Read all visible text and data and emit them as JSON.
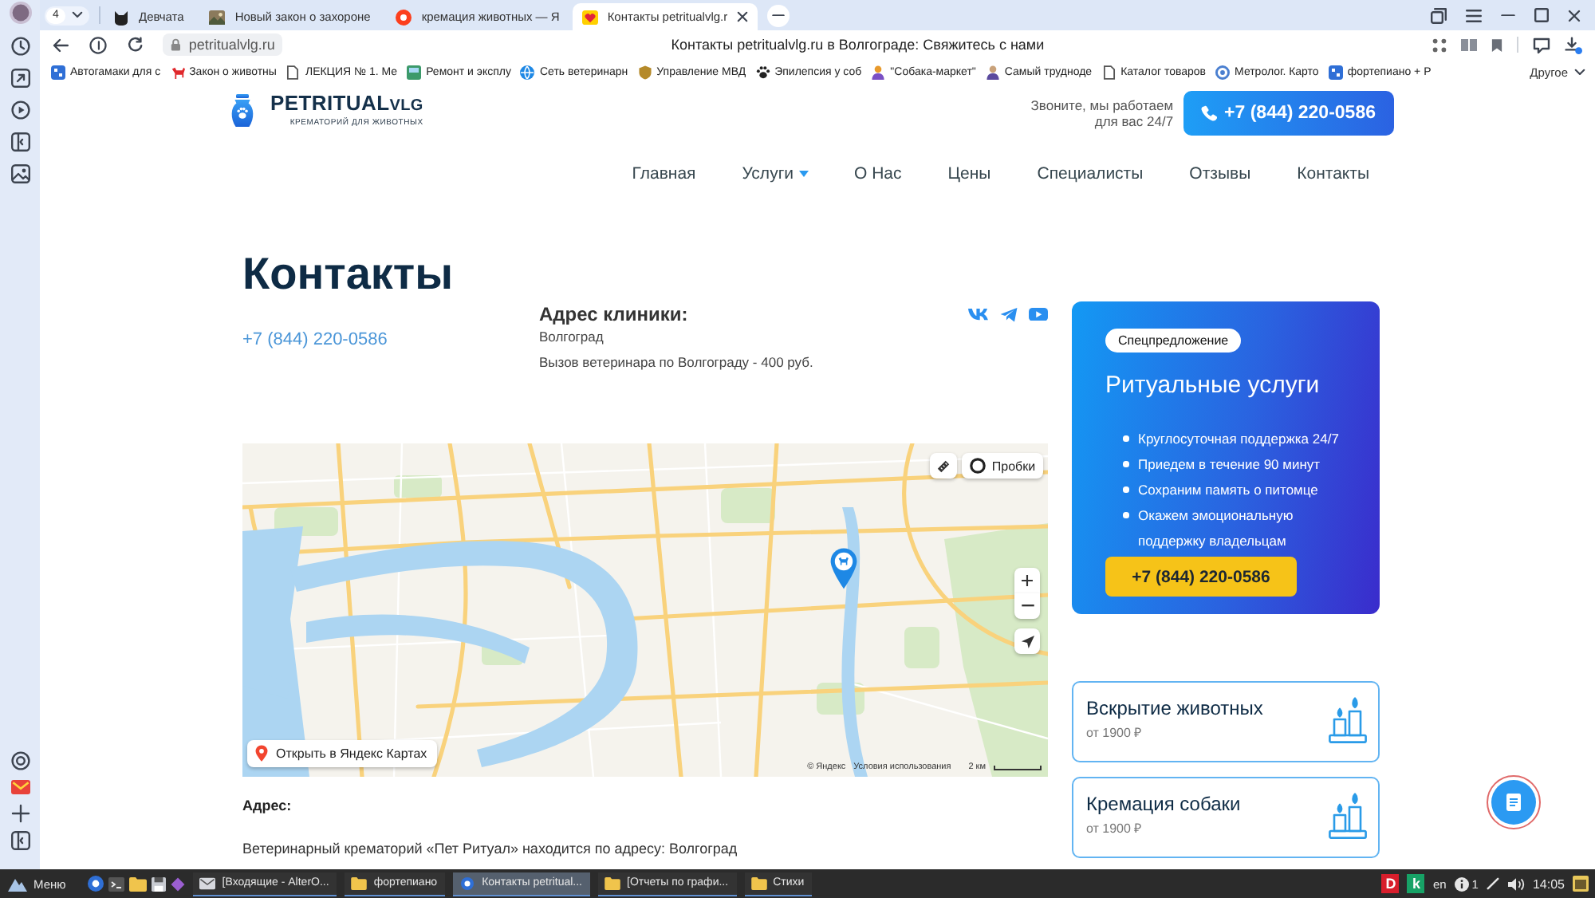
{
  "browser": {
    "tab_count": "4",
    "tabs": [
      {
        "title": "Девчата",
        "selected": false
      },
      {
        "title": "Новый закон о захороне",
        "selected": false
      },
      {
        "title": "кремация животных — Я",
        "selected": false
      },
      {
        "title": "Контакты petritualvlg.r",
        "selected": true
      }
    ],
    "url": "petritualvlg.ru",
    "page_title": "Контакты petritualvlg.ru в Волгограде: Свяжитесь с нами",
    "bookmarks": [
      "Автогамаки для с",
      "Закон о животны",
      "ЛЕКЦИЯ № 1. Ме",
      "Ремонт и эксплу",
      "Сеть ветеринарн",
      "Управление МВД",
      "Эпилепсия у соб",
      "\"Собака-маркет\"",
      "Самый трудноде",
      "Каталог товаров",
      "Метролог. Карто",
      "фортепиано + Р"
    ],
    "bookmarks_more": "Другое"
  },
  "header": {
    "brand": "PETRITUAL",
    "brand_suffix": "VLG",
    "tagline": "КРЕМАТОРИЙ ДЛЯ ЖИВОТНЫХ",
    "call_note": "Звоните, мы работаем для вас 24/7",
    "phone_button": "+7 (844) 220-0586"
  },
  "nav": [
    {
      "label": "Главная",
      "dropdown": false
    },
    {
      "label": "Услуги",
      "dropdown": true
    },
    {
      "label": "О Нас",
      "dropdown": false
    },
    {
      "label": "Цены",
      "dropdown": false
    },
    {
      "label": "Специалисты",
      "dropdown": false
    },
    {
      "label": "Отзывы",
      "dropdown": false
    },
    {
      "label": "Контакты",
      "dropdown": false
    }
  ],
  "contacts": {
    "title": "Контакты",
    "phone": "+7 (844) 220-0586",
    "address_heading": "Адрес клиники:",
    "city": "Волгоград",
    "visit_note": "Вызов ветеринара по Волгограду - 400 руб."
  },
  "promo": {
    "badge": "Спецпредложение",
    "title": "Ритуальные услуги",
    "items": [
      "Круглосуточная поддержка 24/7",
      "Приедем в течение 90 минут",
      "Сохраним память о питомце",
      "Окажем эмоциональную поддержку владельцам"
    ],
    "button": "+7 (844) 220-0586"
  },
  "map": {
    "traffic_button": "Пробки",
    "open_link": "Открыть в Яндекс Картах",
    "copyright": "© Яндекс",
    "terms_link": "Условия использования",
    "scale": "2 км"
  },
  "services": [
    {
      "title": "Вскрытие животных",
      "price": "от 1900 ₽"
    },
    {
      "title": "Кремация собаки",
      "price": "от 1900 ₽"
    }
  ],
  "address": {
    "heading": "Адрес:",
    "text": "Ветеринарный крематорий «Пет Ритуал» находится по адресу: Волгоград"
  },
  "taskbar": {
    "menu": "Меню",
    "windows": [
      {
        "title": "[Входящие - AlterO...",
        "selected": false
      },
      {
        "title": "фортепиано",
        "selected": false
      },
      {
        "title": "Контакты petritual...",
        "selected": true
      },
      {
        "title": "[Отчеты по графи...",
        "selected": false
      },
      {
        "title": "Стихи",
        "selected": false
      }
    ],
    "tray_apps": [
      {
        "label": "D",
        "color": "#d81e2c"
      },
      {
        "label": "k",
        "color": "#17a266"
      }
    ],
    "keyboard_layout": "en",
    "notifications": "1",
    "clock": "14:05"
  }
}
